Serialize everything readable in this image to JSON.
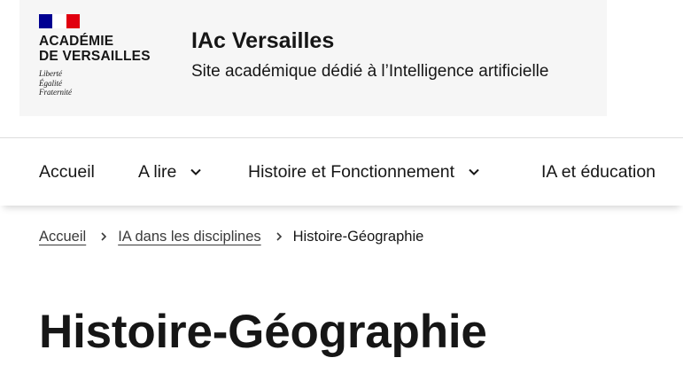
{
  "header": {
    "brand": {
      "line1": "ACADÉMIE",
      "line2": "DE VERSAILLES",
      "motto": [
        "Liberté",
        "Égalité",
        "Fraternité"
      ],
      "flag_colors": [
        "#000091",
        "#ffffff",
        "#e1000f"
      ]
    },
    "site_title": "IAc Versailles",
    "tagline": "Site académique dédié à l’Intelligence artificielle"
  },
  "nav": {
    "items": [
      {
        "label": "Accueil",
        "icon": ""
      },
      {
        "label": "A lire",
        "icon": "chevron-down-icon"
      },
      {
        "label": "Histoire et Fonctionnement",
        "icon": "chevron-down-icon"
      },
      {
        "label": "IA et éducation",
        "icon": ""
      }
    ]
  },
  "breadcrumb": {
    "items": [
      {
        "label": "Accueil"
      },
      {
        "label": "IA dans les disciplines"
      }
    ],
    "current": "Histoire-Géographie",
    "separator_icon": "chevron-right-icon"
  },
  "main": {
    "title": "Histoire-Géographie"
  }
}
